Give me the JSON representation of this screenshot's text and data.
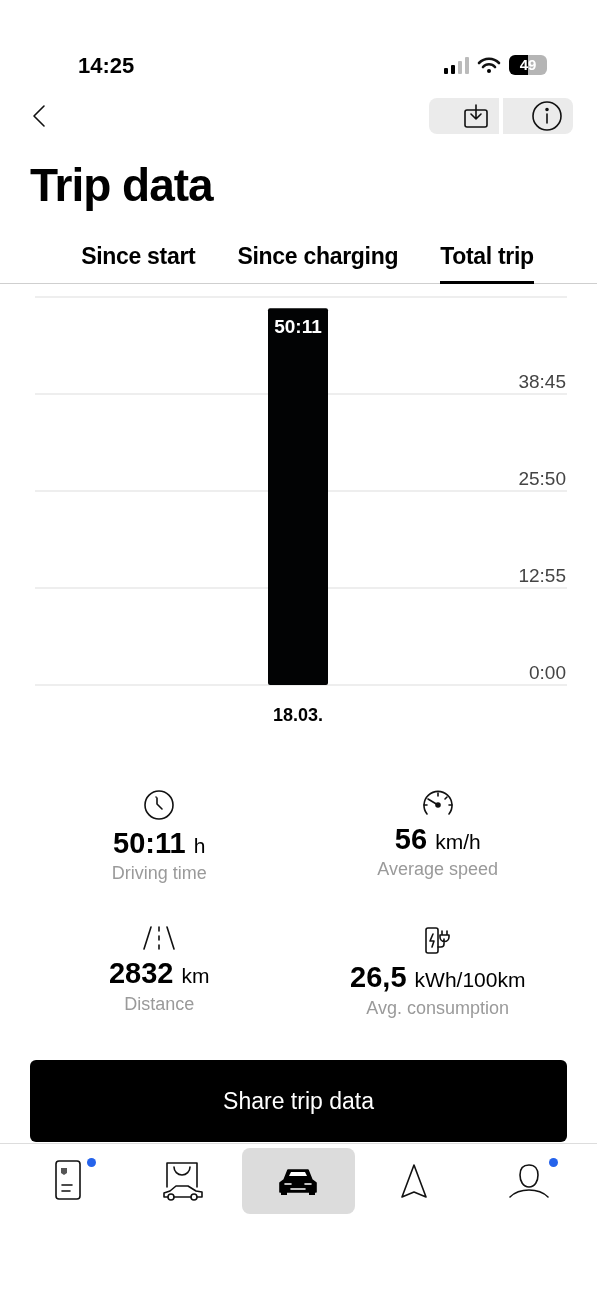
{
  "status_bar": {
    "time": "14:25",
    "battery": "49"
  },
  "title": "Trip data",
  "tabs": [
    {
      "label": "Since start",
      "selected": false
    },
    {
      "label": "Since charging",
      "selected": false
    },
    {
      "label": "Total trip",
      "selected": true
    }
  ],
  "chart": {
    "chart_data": {
      "type": "bar",
      "grid": true,
      "categories": [
        "18.03."
      ],
      "values": [
        3011
      ],
      "ylim": [
        0,
        3100
      ],
      "yticks": [
        {
          "value": 0,
          "label": "0:00"
        },
        {
          "value": 775,
          "label": "12:55"
        },
        {
          "value": 1550,
          "label": "25:50"
        },
        {
          "value": 2325,
          "label": "38:45"
        }
      ],
      "value_labels": [
        "50:11"
      ]
    }
  },
  "stats": [
    {
      "kind": "time",
      "value": "50:11",
      "unit": "h",
      "label": "Driving time"
    },
    {
      "kind": "speed",
      "value": "56",
      "unit": "km/h",
      "label": "Average speed"
    },
    {
      "kind": "distance",
      "value": "2832",
      "unit": "km",
      "label": "Distance"
    },
    {
      "kind": "consumption",
      "value": "26,5",
      "unit": "kWh/100km",
      "label": "Avg. consumption"
    }
  ],
  "share_button": "Share trip data",
  "nav": [
    {
      "kind": "documents",
      "selected": false,
      "badge": true
    },
    {
      "kind": "shop",
      "selected": false,
      "badge": false
    },
    {
      "kind": "car",
      "selected": true,
      "badge": false
    },
    {
      "kind": "navigation",
      "selected": false,
      "badge": false
    },
    {
      "kind": "profile",
      "selected": false,
      "badge": true
    }
  ]
}
